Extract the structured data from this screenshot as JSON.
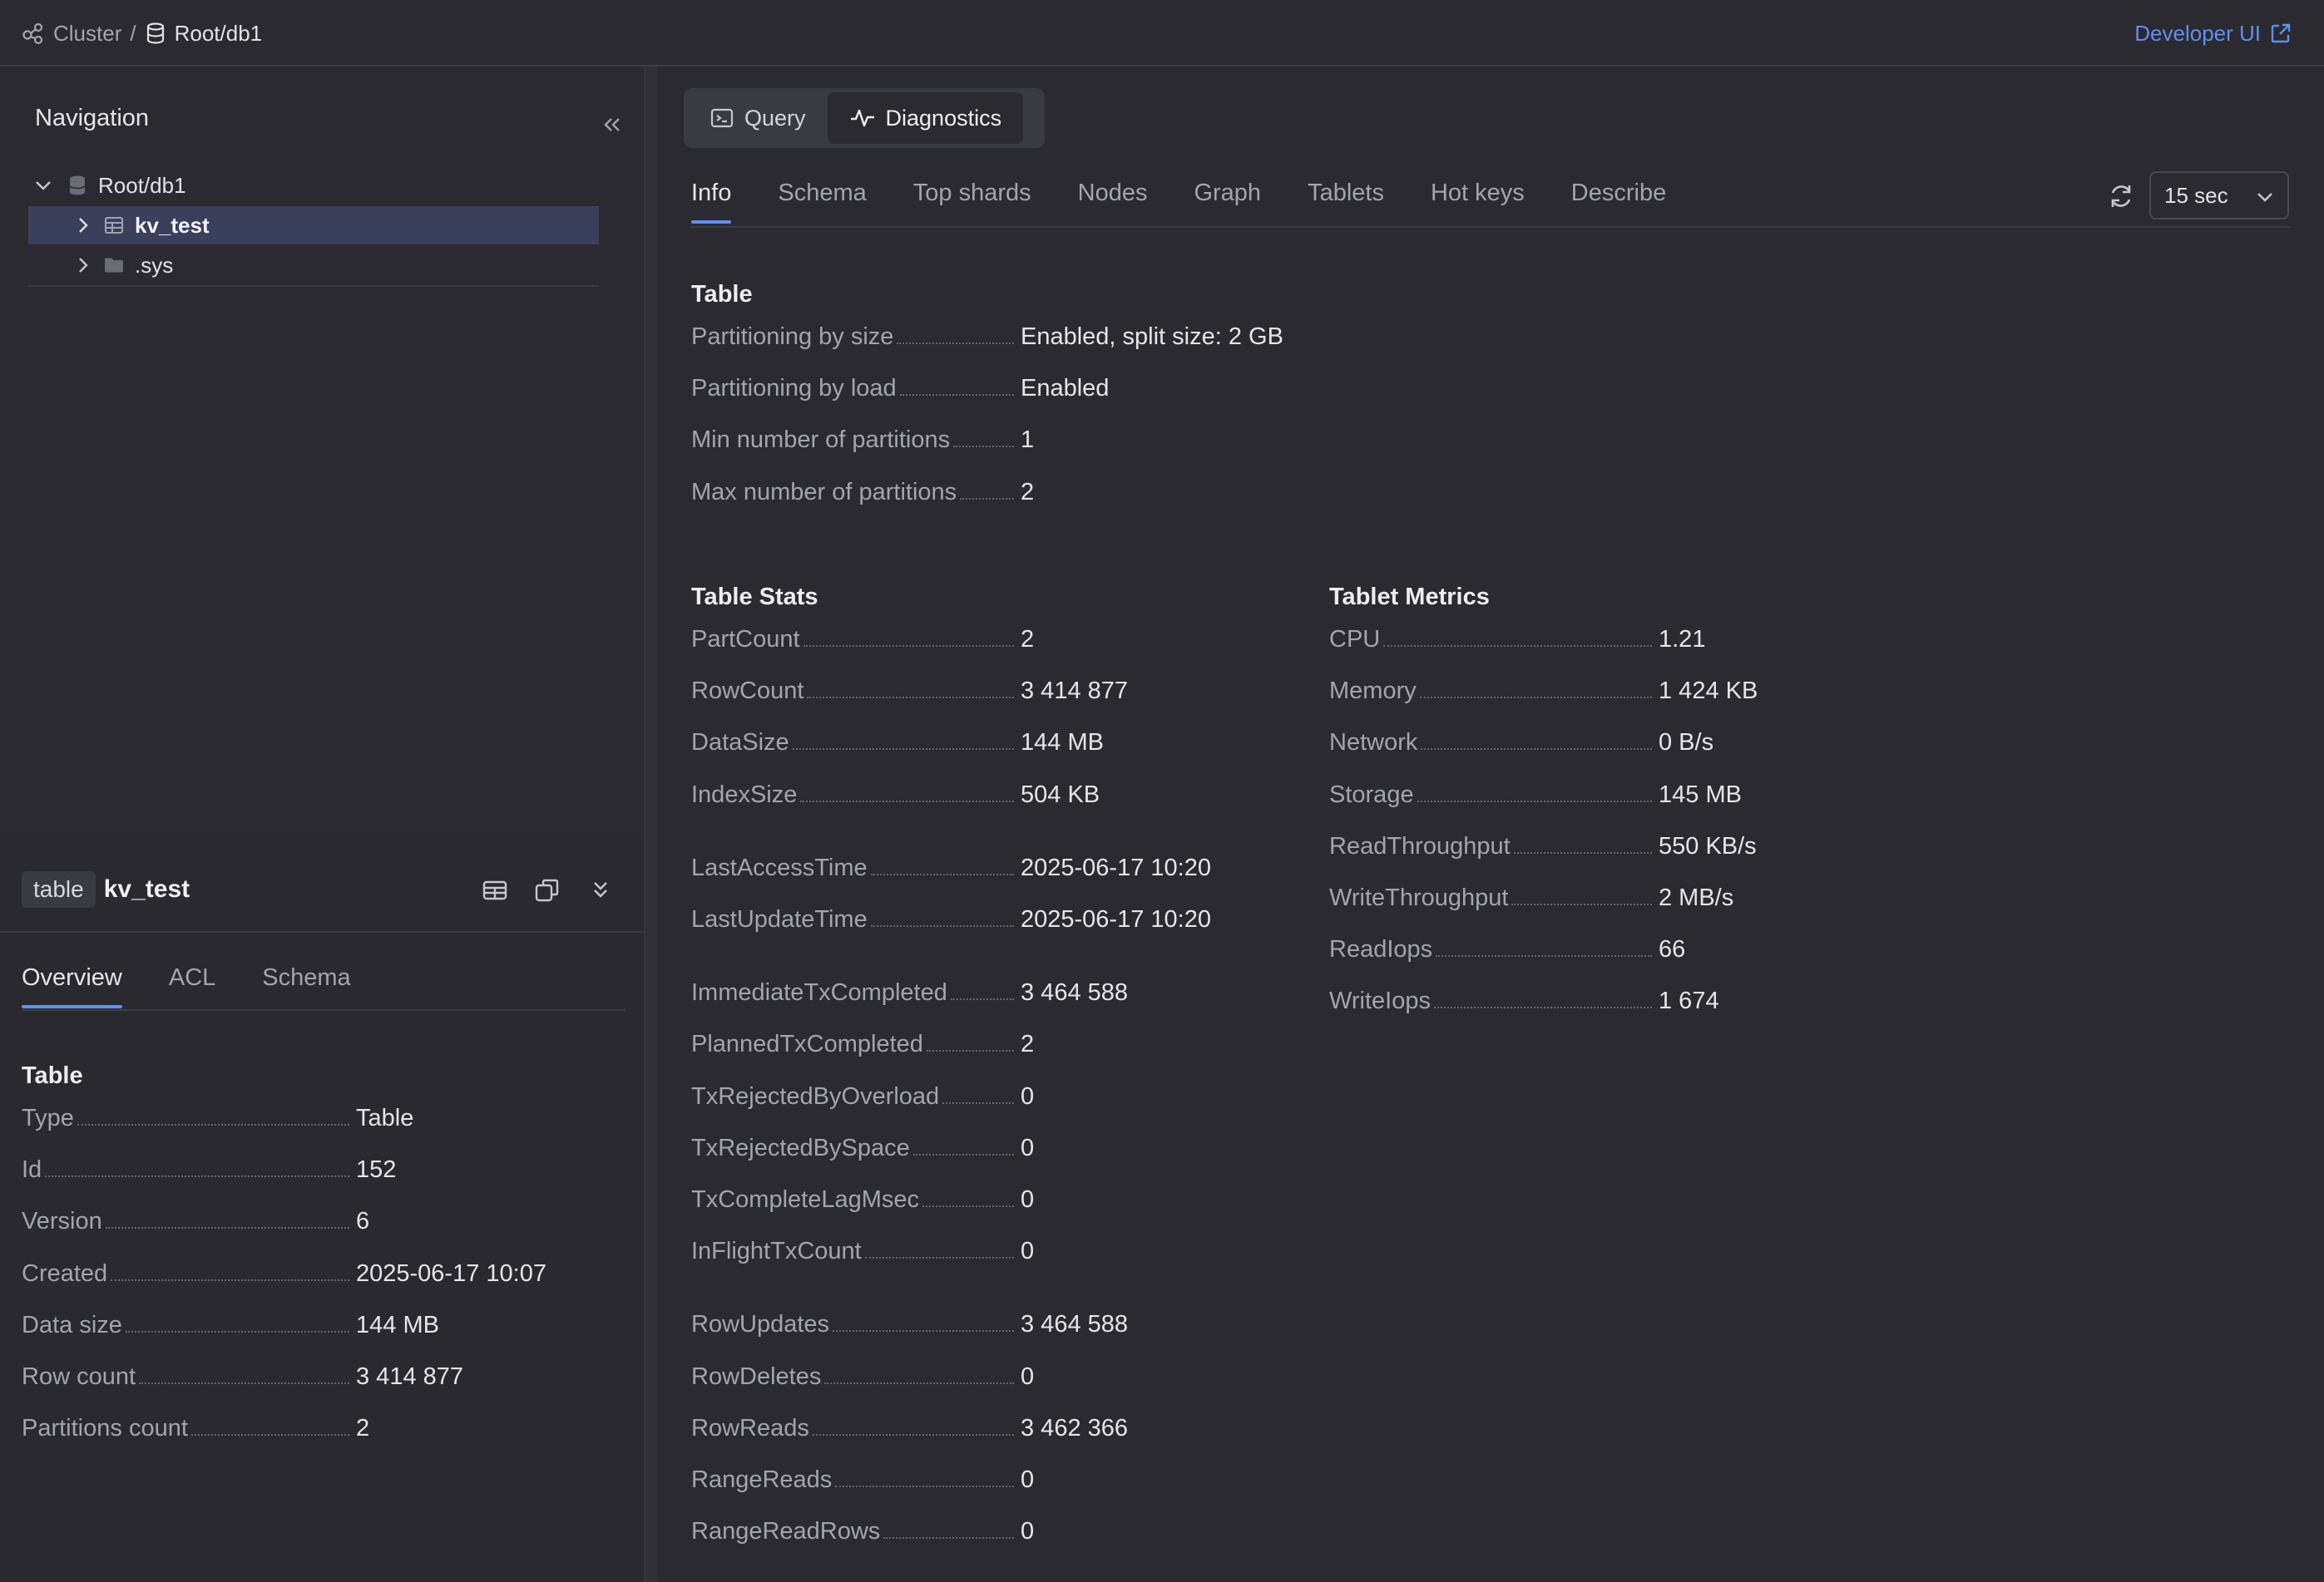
{
  "breadcrumb": {
    "cluster": "Cluster",
    "separator": "/",
    "database": "Root/db1"
  },
  "developer_link": "Developer UI",
  "navigation": {
    "title": "Navigation",
    "tree": [
      {
        "label": "Root/db1",
        "type": "database",
        "expanded": true
      },
      {
        "label": "kv_test",
        "type": "table",
        "selected": true
      },
      {
        "label": ".sys",
        "type": "folder"
      }
    ]
  },
  "object_panel": {
    "kind": "table",
    "name": "kv_test",
    "tabs": [
      "Overview",
      "ACL",
      "Schema"
    ],
    "active_tab": "Overview",
    "section_title": "Table",
    "fields": [
      {
        "label": "Type",
        "value": "Table"
      },
      {
        "label": "Id",
        "value": "152"
      },
      {
        "label": "Version",
        "value": "6"
      },
      {
        "label": "Created",
        "value": "2025-06-17 10:07"
      },
      {
        "label": "Data size",
        "value": "144 MB"
      },
      {
        "label": "Row count",
        "value": "3 414 877"
      },
      {
        "label": "Partitions count",
        "value": "2"
      }
    ]
  },
  "mode_switch": {
    "query": "Query",
    "diagnostics": "Diagnostics",
    "active": "Diagnostics"
  },
  "info_tabs": [
    "Info",
    "Schema",
    "Top shards",
    "Nodes",
    "Graph",
    "Tablets",
    "Hot keys",
    "Describe"
  ],
  "active_info_tab": "Info",
  "refresh_interval": "15 sec",
  "table_section": {
    "title": "Table",
    "fields": [
      {
        "label": "Partitioning by size",
        "value": "Enabled, split size: 2 GB"
      },
      {
        "label": "Partitioning by load",
        "value": "Enabled"
      },
      {
        "label": "Min number of partitions",
        "value": "1"
      },
      {
        "label": "Max number of partitions",
        "value": "2"
      }
    ]
  },
  "table_stats": {
    "title": "Table Stats",
    "groups": [
      [
        {
          "label": "PartCount",
          "value": "2"
        },
        {
          "label": "RowCount",
          "value": "3 414 877"
        },
        {
          "label": "DataSize",
          "value": "144 MB"
        },
        {
          "label": "IndexSize",
          "value": "504 KB"
        }
      ],
      [
        {
          "label": "LastAccessTime",
          "value": "2025-06-17 10:20"
        },
        {
          "label": "LastUpdateTime",
          "value": "2025-06-17 10:20"
        }
      ],
      [
        {
          "label": "ImmediateTxCompleted",
          "value": "3 464 588"
        },
        {
          "label": "PlannedTxCompleted",
          "value": "2"
        },
        {
          "label": "TxRejectedByOverload",
          "value": "0"
        },
        {
          "label": "TxRejectedBySpace",
          "value": "0"
        },
        {
          "label": "TxCompleteLagMsec",
          "value": "0"
        },
        {
          "label": "InFlightTxCount",
          "value": "0"
        }
      ],
      [
        {
          "label": "RowUpdates",
          "value": "3 464 588"
        },
        {
          "label": "RowDeletes",
          "value": "0"
        },
        {
          "label": "RowReads",
          "value": "3 462 366"
        },
        {
          "label": "RangeReads",
          "value": "0"
        },
        {
          "label": "RangeReadRows",
          "value": "0"
        }
      ]
    ]
  },
  "tablet_metrics": {
    "title": "Tablet Metrics",
    "fields": [
      {
        "label": "CPU",
        "value": "1.21"
      },
      {
        "label": "Memory",
        "value": "1 424 KB"
      },
      {
        "label": "Network",
        "value": "0 B/s"
      },
      {
        "label": "Storage",
        "value": "145 MB"
      },
      {
        "label": "ReadThroughput",
        "value": "550 KB/s"
      },
      {
        "label": "WriteThroughput",
        "value": "2 MB/s"
      },
      {
        "label": "ReadIops",
        "value": "66"
      },
      {
        "label": "WriteIops",
        "value": "1 674"
      }
    ]
  }
}
